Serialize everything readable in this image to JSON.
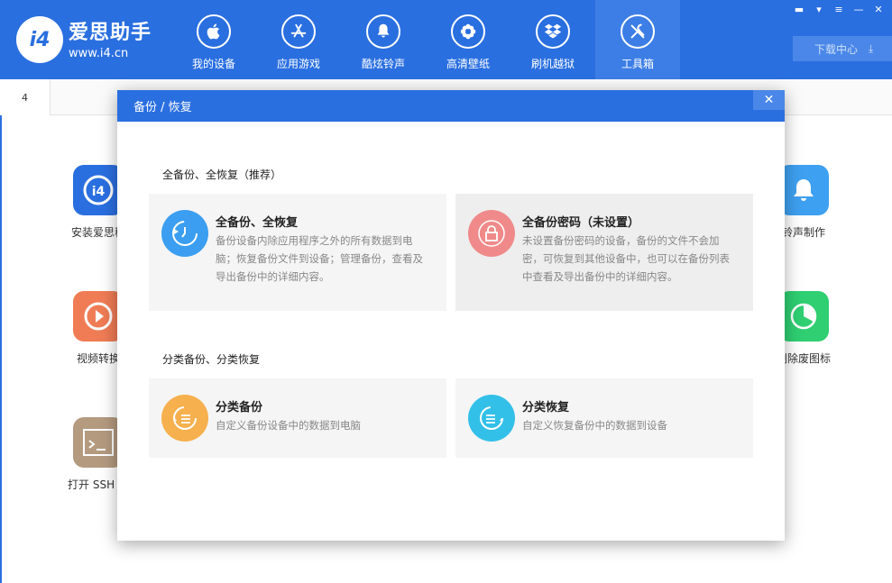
{
  "app": {
    "brand_name": "爱思助手",
    "brand_url": "www.i4.cn",
    "logo_text": "i4"
  },
  "nav": [
    {
      "label": "我的设备",
      "icon": "apple-icon"
    },
    {
      "label": "应用游戏",
      "icon": "app-store-icon"
    },
    {
      "label": "酷炫铃声",
      "icon": "bell-icon"
    },
    {
      "label": "高清壁纸",
      "icon": "flower-icon"
    },
    {
      "label": "刷机越狱",
      "icon": "dropbox-icon"
    },
    {
      "label": "工具箱",
      "icon": "tools-icon",
      "active": true
    }
  ],
  "window_controls": [
    "message-icon",
    "shirt-icon",
    "menu-icon",
    "minimize-icon",
    "close-icon"
  ],
  "download_center": {
    "label": "下载中心"
  },
  "tab": {
    "label": "4"
  },
  "background_tools": {
    "left": [
      {
        "label": "安装爱思移",
        "icon": "i4-icon",
        "color": "#2a6fe0"
      },
      {
        "label": "视频转换",
        "icon": "play-icon",
        "color": "#f07c55"
      },
      {
        "label": "打开 SSH 通",
        "icon": "terminal-icon",
        "color": "#b49a7f"
      }
    ],
    "right": [
      {
        "label": "铃声制作",
        "icon": "bell-plus-icon",
        "color": "#3ea0f0"
      },
      {
        "label": "删除废图标",
        "icon": "pie-icon",
        "color": "#2fcf72"
      }
    ]
  },
  "modal": {
    "title": "备份 / 恢复",
    "close_label": "✕",
    "section1_title": "全备份、全恢复（推荐）",
    "section2_title": "分类备份、分类恢复",
    "cards": [
      {
        "title": "全备份、全恢复",
        "desc": "备份设备内除应用程序之外的所有数据到电脑；恢复备份文件到设备；管理备份，查看及导出备份中的详细内容。",
        "color": "#3c9ef0",
        "icon": "restore-clock-icon"
      },
      {
        "title": "全备份密码（未设置）",
        "desc": "未设置备份密码的设备，备份的文件不会加密，可恢复到其他设备中，也可以在备份列表中查看及导出备份中的详细内容。",
        "color": "#f08a8a",
        "icon": "lock-icon"
      },
      {
        "title": "分类备份",
        "desc": "自定义备份设备中的数据到电脑",
        "color": "#f6b04d",
        "icon": "backup-list-icon"
      },
      {
        "title": "分类恢复",
        "desc": "自定义恢复备份中的数据到设备",
        "color": "#33c0e8",
        "icon": "restore-list-icon"
      }
    ]
  }
}
